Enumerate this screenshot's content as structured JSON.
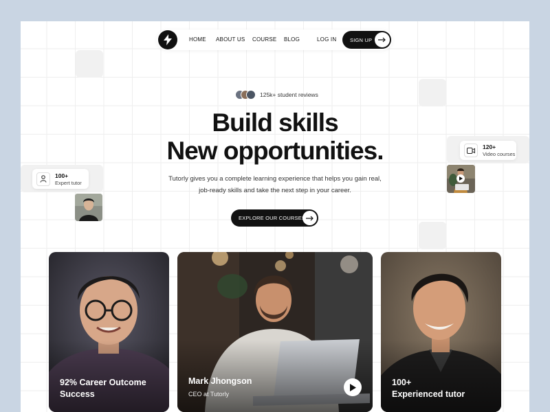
{
  "nav": {
    "items": [
      {
        "label": "HOME"
      },
      {
        "label": "ABOUT US"
      },
      {
        "label": "COURSE"
      },
      {
        "label": "BLOG"
      }
    ],
    "login_label": "LOG IN",
    "signup_label": "SIGN UP"
  },
  "reviews": {
    "text": "125k+ student reviews"
  },
  "hero": {
    "title_line1": "Build skills",
    "title_line2": "New opportunities.",
    "subtitle_line1": "Tutorly gives you a complete learning experience that helps you gain real,",
    "subtitle_line2": "job-ready skills and take the next step in your career."
  },
  "cta": {
    "label": "EXPLORE OUR COURSES"
  },
  "stats": {
    "tutors": {
      "value": "100+",
      "label": "Expert tutor"
    },
    "videos": {
      "value": "120+",
      "label": "Video courses"
    }
  },
  "cards": [
    {
      "title_line1": "92% Career Outcome",
      "title_line2": "Success"
    },
    {
      "name": "Mark Jhongson",
      "role": "CEO at Tutorly"
    },
    {
      "title_line1": "100+",
      "title_line2": "Experienced tutor"
    }
  ],
  "colors": {
    "accent": "#111111",
    "background": "#c9d5e3",
    "tile": "#f1f1f1"
  },
  "icons": [
    "bolt-icon",
    "arrow-right-icon",
    "user-icon",
    "video-icon",
    "play-icon"
  ]
}
